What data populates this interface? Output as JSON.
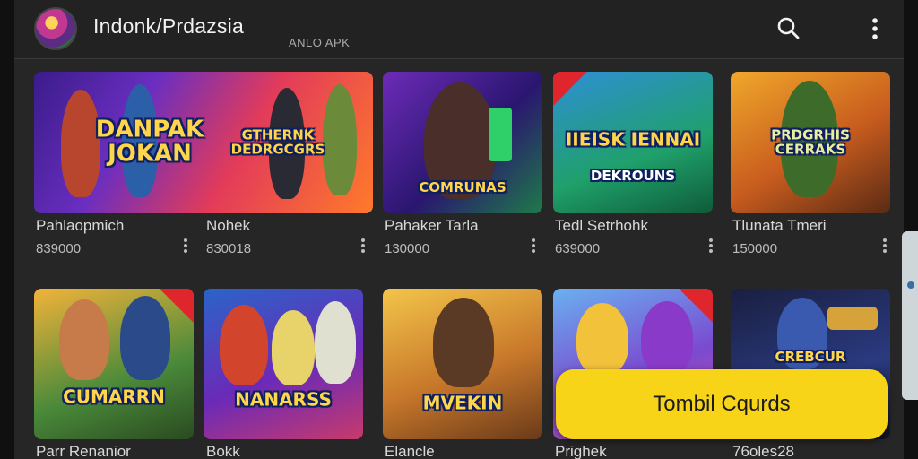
{
  "app": {
    "title": "Indonk/Prdazsia",
    "subtitle": "ANLO APK"
  },
  "icons": {
    "avatar": "app-avatar",
    "search": "search-icon",
    "more": "more-vert-icon",
    "card_more": "more-vert-icon"
  },
  "cards_row1": [
    {
      "art_text": "DANPAK JOKAN",
      "art_text2": "GTHERNK DEDRGCGRS",
      "title": "Pahlaopmich",
      "meta": "839000"
    },
    {
      "art_text": "",
      "art_text2": "",
      "title": "Nohek",
      "meta": "830018"
    },
    {
      "art_text": "COMRUNAS",
      "art_text2": "",
      "title": "Pahaker Tarla",
      "meta": "130000"
    },
    {
      "art_text": "IIEISK IENNAI",
      "art_text2": "DEKROUNS",
      "title": "Tedl Setrhohk",
      "meta": "639000"
    },
    {
      "art_text": "PRDGRHIS CERRAKS",
      "art_text2": "",
      "title": "Tlunata Tmeri",
      "meta": "150000"
    }
  ],
  "cards_row2": [
    {
      "art_text": "CUMARRN",
      "title": "Parr Renanior"
    },
    {
      "art_text": "NANARSS",
      "title": "Bokk"
    },
    {
      "art_text": "MVEKIN",
      "title": "Elancle"
    },
    {
      "art_text": "",
      "title": "Prighek"
    },
    {
      "art_text": "CREBCUR",
      "title": "76oles28"
    }
  ],
  "cta": {
    "label": "Tombil Cqurds"
  },
  "colors": {
    "accent": "#f7d418",
    "background": "#262626"
  }
}
